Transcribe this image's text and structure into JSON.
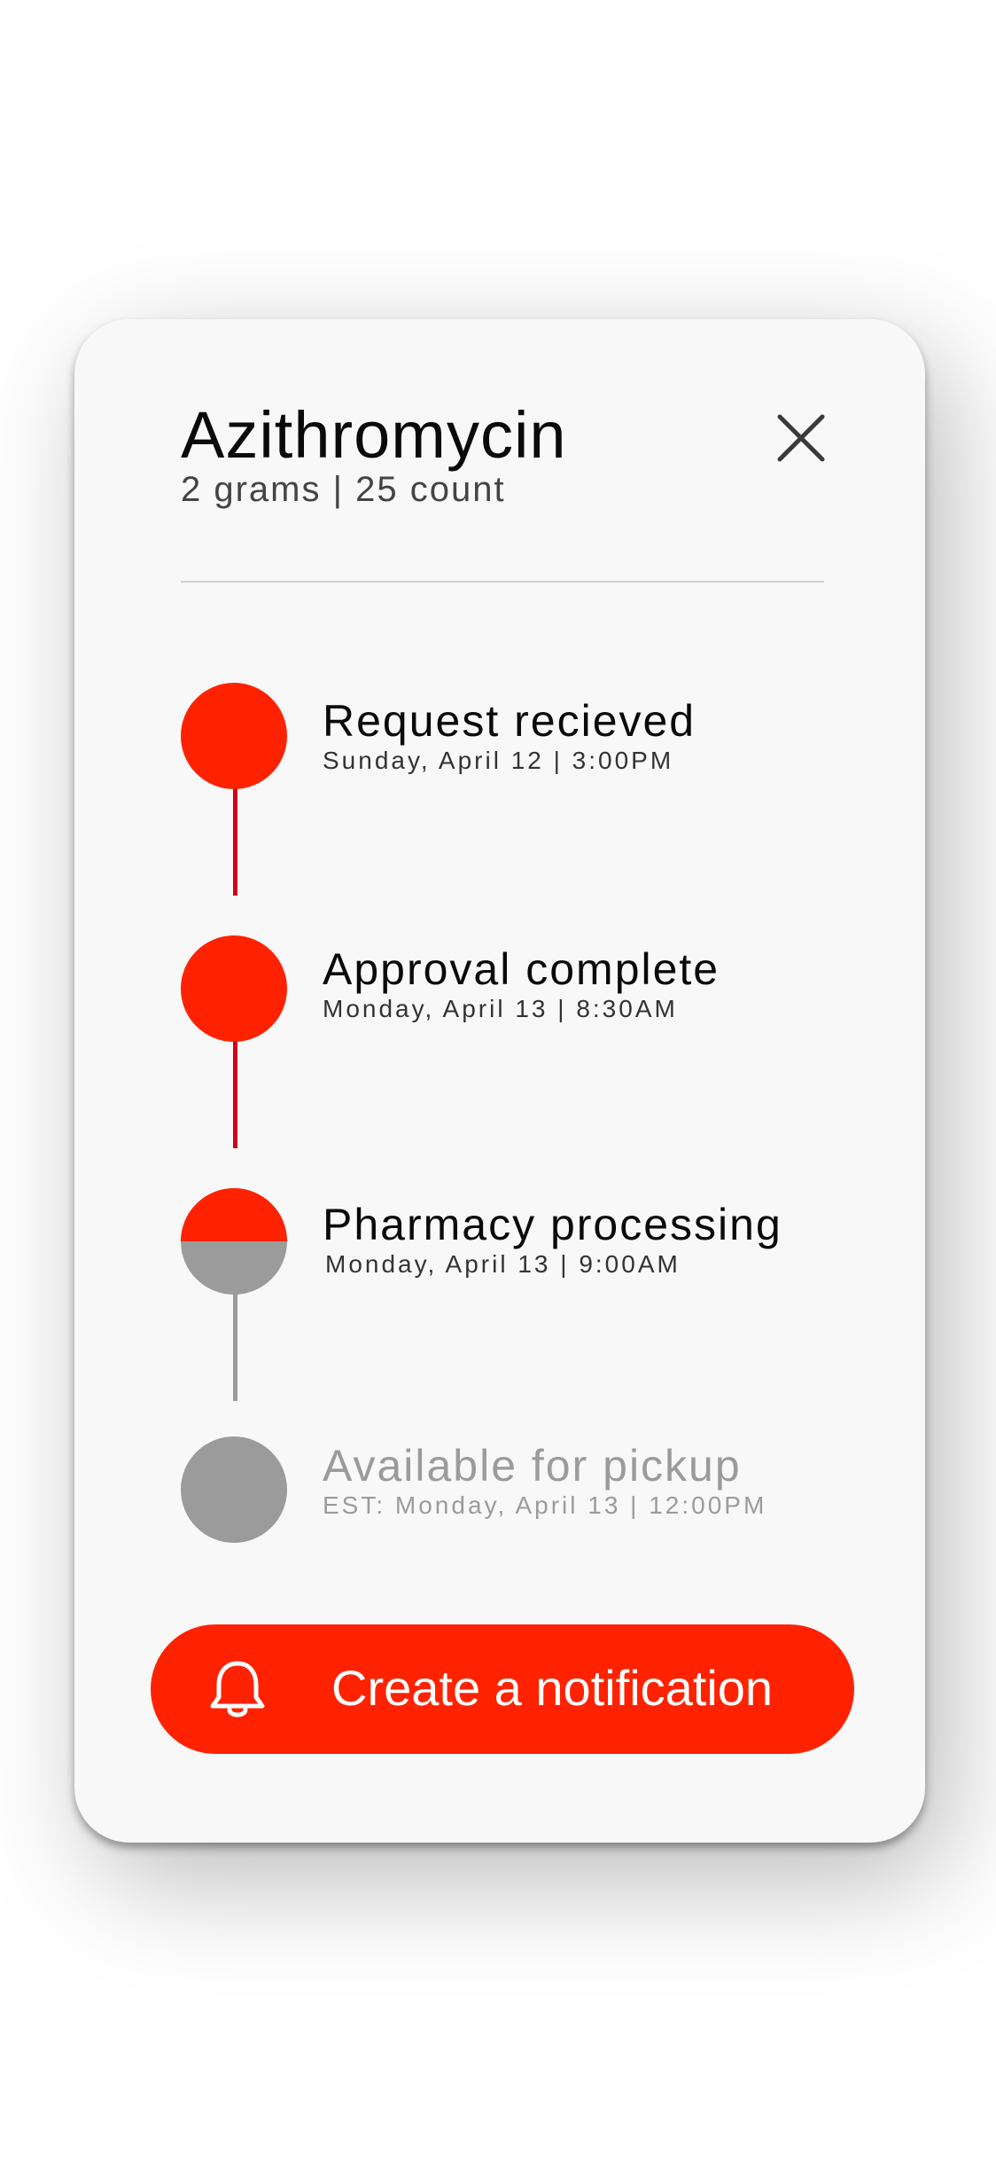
{
  "medication": {
    "name": "Azithromycin",
    "details": "2 grams | 25 count"
  },
  "close_icon": "close-icon",
  "steps": [
    {
      "title": "Request recieved",
      "date": "Sunday, April 12 | 3:00PM",
      "status": "complete"
    },
    {
      "title": "Approval complete",
      "date": "Monday, April 13 | 8:30AM",
      "status": "complete"
    },
    {
      "title": "Pharmacy processing",
      "date": "Monday, April 13 | 9:00AM",
      "status": "in-progress",
      "progress": 0.5
    },
    {
      "title": "Available for pickup",
      "date": "EST: Monday, April 13 | 12:00PM",
      "status": "pending"
    }
  ],
  "notify_button": {
    "label": "Create a notification",
    "icon": "bell-icon"
  },
  "colors": {
    "accent": "#ff2200",
    "line_active": "#d0021b",
    "pending": "#9b9b9b",
    "card": "#f8f8f8"
  }
}
